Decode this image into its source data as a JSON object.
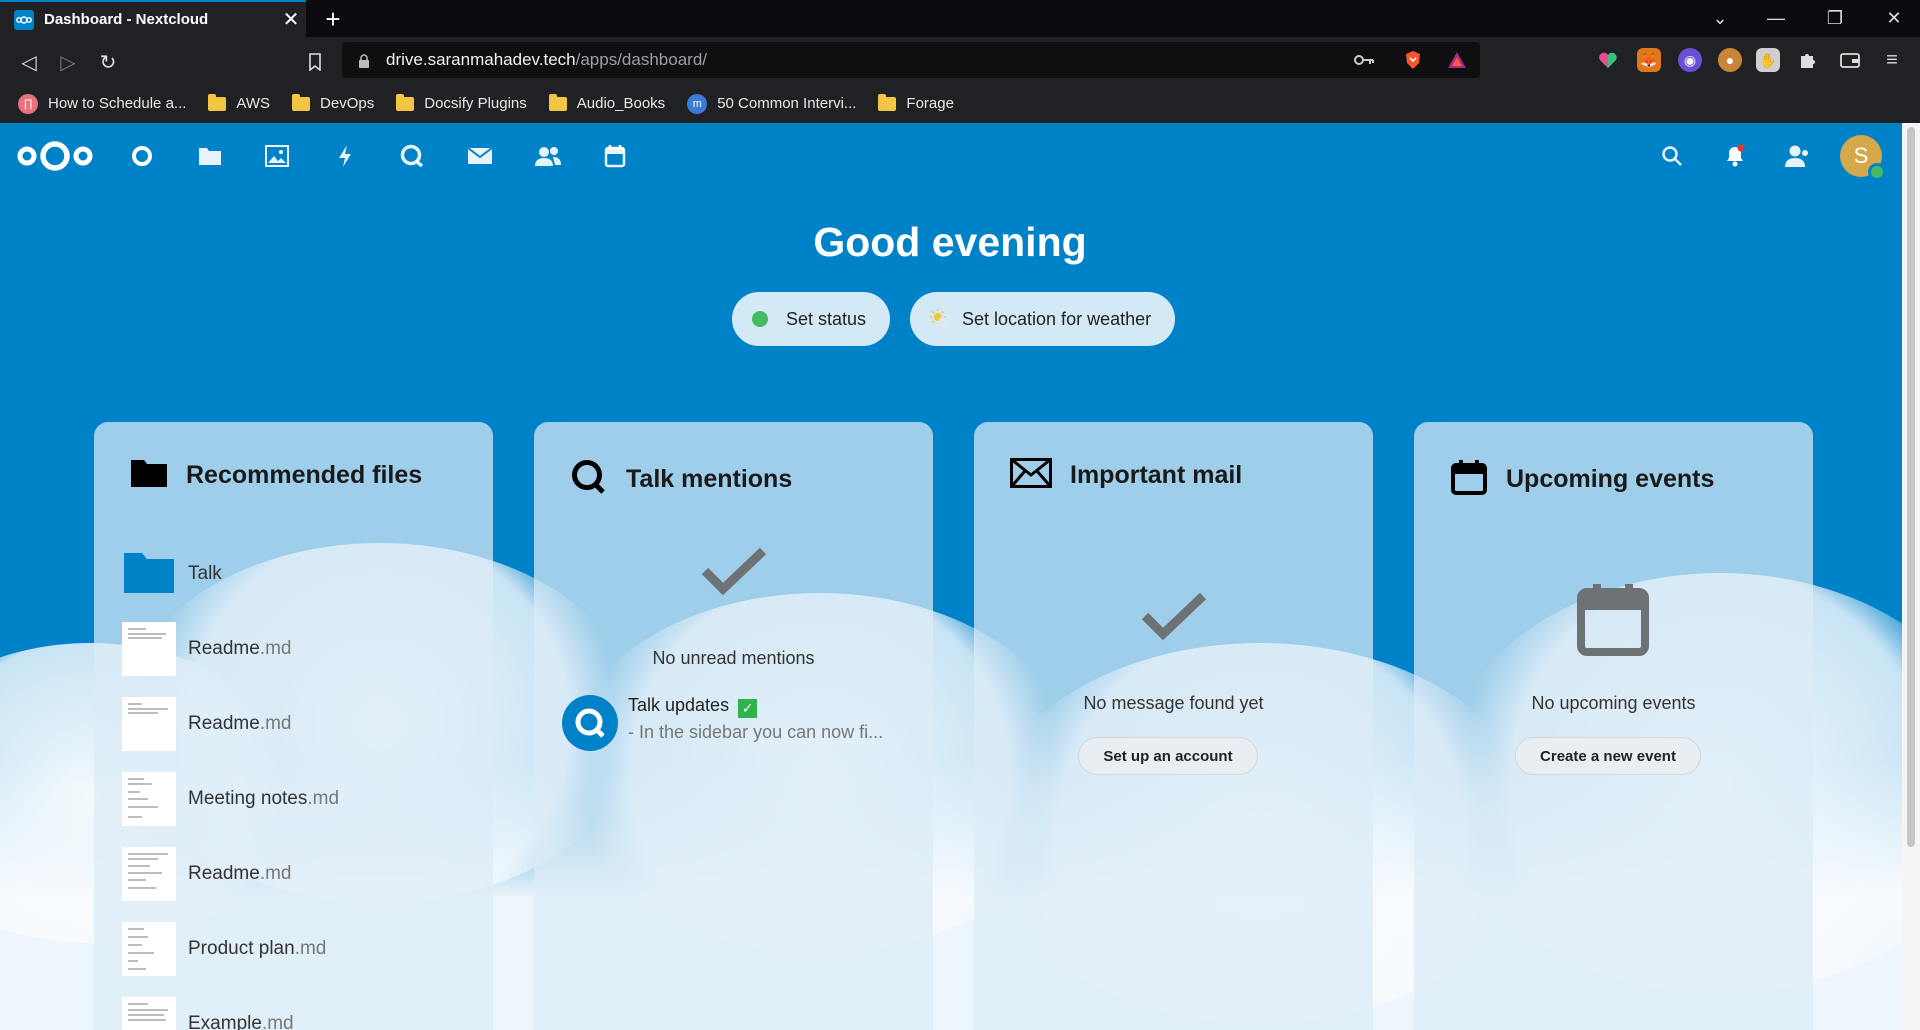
{
  "browser": {
    "tab_title": "Dashboard - Nextcloud",
    "url_domain": "drive.saranmahadev.tech",
    "url_path": "/apps/dashboard/",
    "bookmarks": [
      {
        "label": "How to Schedule a...",
        "kind": "site"
      },
      {
        "label": "AWS",
        "kind": "folder"
      },
      {
        "label": "DevOps",
        "kind": "folder"
      },
      {
        "label": "Docsify Plugins",
        "kind": "folder"
      },
      {
        "label": "Audio_Books",
        "kind": "folder"
      },
      {
        "label": "50 Common Intervi...",
        "kind": "site"
      },
      {
        "label": "Forage",
        "kind": "folder"
      }
    ]
  },
  "header": {
    "avatar_initial": "S"
  },
  "greeting": "Good evening",
  "status": {
    "set_status_label": "Set status",
    "weather_label": "Set location for weather"
  },
  "widgets": {
    "recommended": {
      "title": "Recommended files",
      "files": [
        {
          "name": "Talk",
          "ext": "",
          "type": "folder"
        },
        {
          "name": "Readme",
          "ext": ".md",
          "type": "doc"
        },
        {
          "name": "Readme",
          "ext": ".md",
          "type": "doc"
        },
        {
          "name": "Meeting notes",
          "ext": ".md",
          "type": "doc"
        },
        {
          "name": "Readme",
          "ext": ".md",
          "type": "doc"
        },
        {
          "name": "Product plan",
          "ext": ".md",
          "type": "doc"
        },
        {
          "name": "Example",
          "ext": ".md",
          "type": "doc"
        }
      ]
    },
    "talk": {
      "title": "Talk mentions",
      "empty": "No unread mentions",
      "item_title": "Talk updates",
      "item_sub": "- In the sidebar you can now fi..."
    },
    "mail": {
      "title": "Important mail",
      "empty": "No message found yet",
      "button": "Set up an account"
    },
    "events": {
      "title": "Upcoming events",
      "empty": "No upcoming events",
      "button": "Create a new event"
    }
  },
  "colors": {
    "primary": "#0082c9",
    "online": "#46ba61",
    "avatar": "#d4a94a"
  }
}
